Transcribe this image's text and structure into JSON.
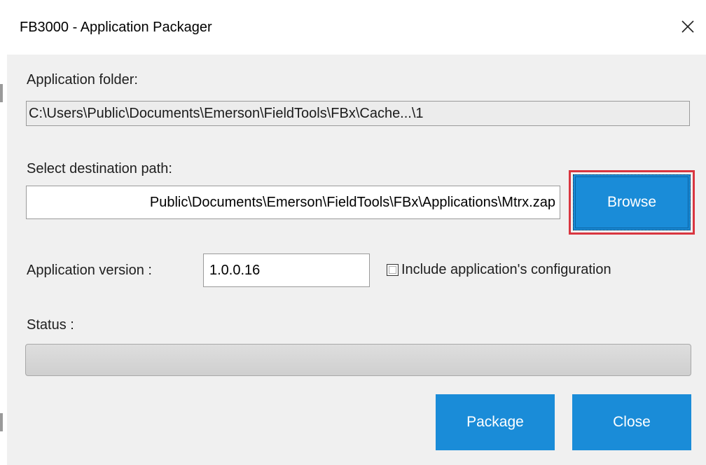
{
  "window": {
    "title": "FB3000 - Application Packager"
  },
  "application_folder": {
    "label": "Application folder:",
    "value": "C:\\Users\\Public\\Documents\\Emerson\\FieldTools\\FBx\\Cache...\\1"
  },
  "destination": {
    "label": "Select destination path:",
    "value": "Public\\Documents\\Emerson\\FieldTools\\FBx\\Applications\\Mtrx.zap",
    "browse_label": "Browse"
  },
  "version": {
    "label": "Application version :",
    "value": "1.0.0.16"
  },
  "include_config": {
    "label": "Include application's configuration",
    "checked": false
  },
  "status": {
    "label": "Status :",
    "progress": 0
  },
  "buttons": {
    "package_label": "Package",
    "close_label": "Close"
  },
  "colors": {
    "accent": "#1a8cd8",
    "highlight": "#d93640",
    "background": "#f0f0f0"
  },
  "icons": {
    "close": "close-icon"
  }
}
